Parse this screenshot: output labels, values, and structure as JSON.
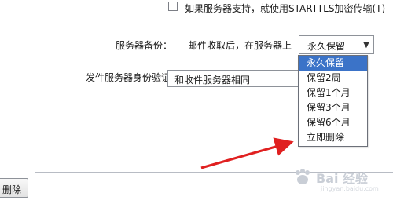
{
  "starttls": {
    "checked": false,
    "label": "如果服务器支持，就使用STARTTLS加密传输(T)"
  },
  "backup": {
    "label": "服务器备份：",
    "description": "邮件收取后，在服务器上",
    "selected": "永久保留",
    "options": [
      "永久保留",
      "保留2周",
      "保留1个月",
      "保留3个月",
      "保留6个月",
      "立即删除"
    ]
  },
  "auth": {
    "label": "发件服务器身份验证：",
    "selected": "和收件服务器相同"
  },
  "buttons": {
    "delete_label": "删除"
  },
  "annotation": {
    "arrow_color": "#e02020"
  },
  "watermark": {
    "text": "Bai 经验",
    "sub": "jingyan.baidu.com"
  },
  "colors": {
    "accent": "#3b73c8",
    "border": "#b8bcc4"
  }
}
